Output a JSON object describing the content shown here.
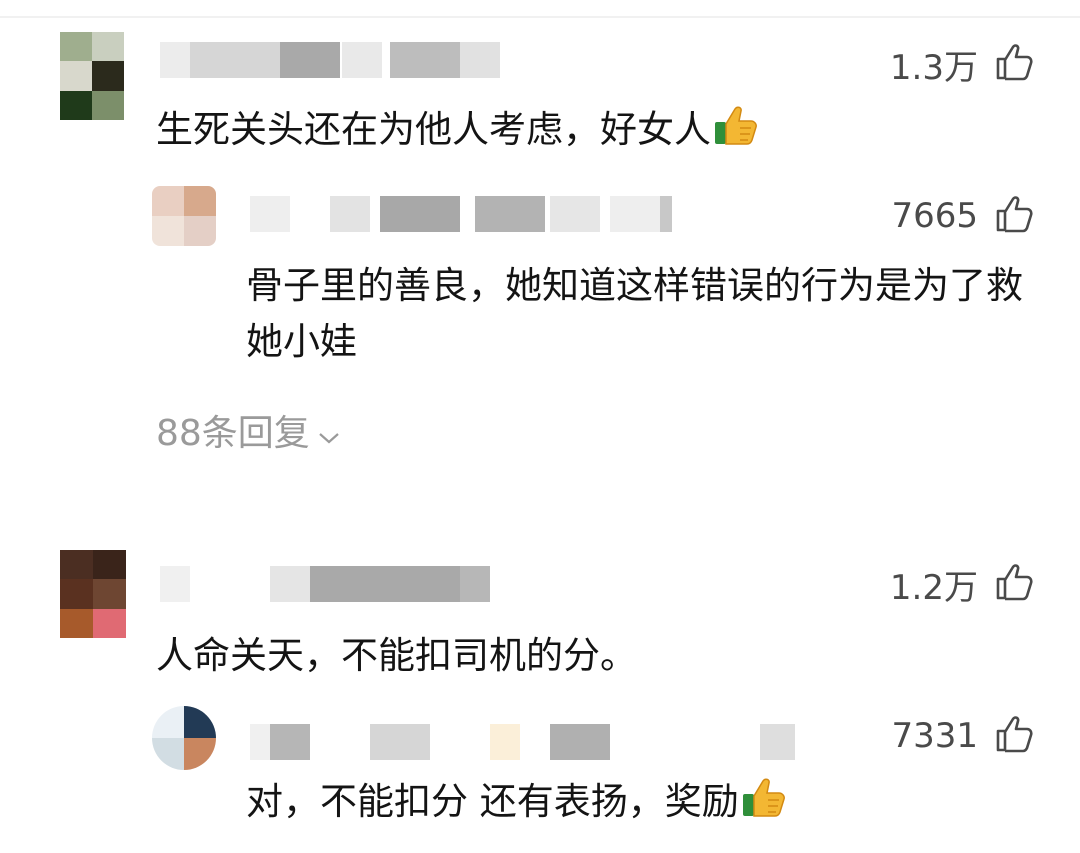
{
  "comments": [
    {
      "likes": "1.3万",
      "text": "生死关头还在为他人考虑，好女人",
      "emoji": "thumbs-up-emoji",
      "reply": {
        "likes": "7665",
        "text": "骨子里的善良，她知道这样错误的行为是为了救她小娃"
      },
      "more_replies": "88条回复"
    },
    {
      "likes": "1.2万",
      "text": "人命关天，不能扣司机的分。",
      "reply": {
        "likes": "7331",
        "text": "对，不能扣分 还有表扬，奖励",
        "emoji": "thumbs-up-emoji"
      }
    }
  ],
  "icons": {
    "like": "thumbs-up-outline-icon",
    "expand": "chevron-down-icon"
  },
  "colors": {
    "text": "#141414",
    "like_count": "#4a4a4a",
    "more_replies": "#9a9a9a"
  }
}
